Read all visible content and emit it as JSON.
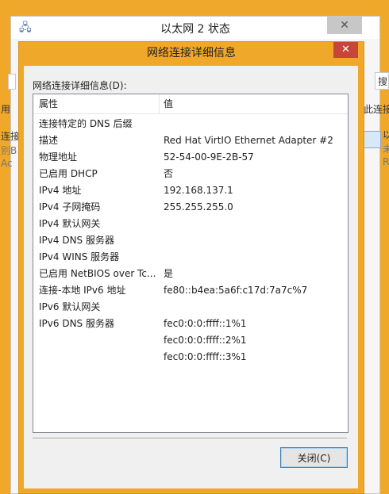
{
  "background_window": {
    "title": "以太网 2 状态",
    "close_glyph": "✕",
    "left_fragments": [
      "用",
      "连接",
      "别B",
      "Ac"
    ],
    "right_fragments": [
      "搜",
      "此连接",
      "以",
      "未",
      "Re"
    ]
  },
  "dialog": {
    "title": "网络连接详细信息",
    "close_glyph": "✕",
    "list_label": "网络连接详细信息(D):",
    "columns": {
      "property": "属性",
      "value": "值"
    },
    "rows": [
      {
        "property": "连接特定的 DNS 后缀",
        "value": ""
      },
      {
        "property": "描述",
        "value": "Red Hat VirtIO Ethernet Adapter #2"
      },
      {
        "property": "物理地址",
        "value": "52-54-00-9E-2B-57"
      },
      {
        "property": "已启用 DHCP",
        "value": "否"
      },
      {
        "property": "IPv4 地址",
        "value": "192.168.137.1"
      },
      {
        "property": "IPv4 子网掩码",
        "value": "255.255.255.0"
      },
      {
        "property": "IPv4 默认网关",
        "value": ""
      },
      {
        "property": "IPv4 DNS 服务器",
        "value": ""
      },
      {
        "property": "IPv4 WINS 服务器",
        "value": ""
      },
      {
        "property": "已启用 NetBIOS over Tc...",
        "value": "是"
      },
      {
        "property": "连接-本地 IPv6 地址",
        "value": "fe80::b4ea:5a6f:c17d:7a7c%7"
      },
      {
        "property": "IPv6 默认网关",
        "value": ""
      },
      {
        "property": "IPv6 DNS 服务器",
        "value": "fec0:0:0:ffff::1%1"
      },
      {
        "property": "",
        "value": "fec0:0:0:ffff::2%1"
      },
      {
        "property": "",
        "value": "fec0:0:0:ffff::3%1"
      }
    ],
    "close_button": "关闭(C)"
  },
  "colors": {
    "accent_frame": "#f0a82a",
    "close_red": "#c7463a",
    "button_border": "#3c7fb1"
  },
  "icons": {
    "background_app": "network-adapter-icon",
    "network_connection": "network-connection-icon"
  }
}
